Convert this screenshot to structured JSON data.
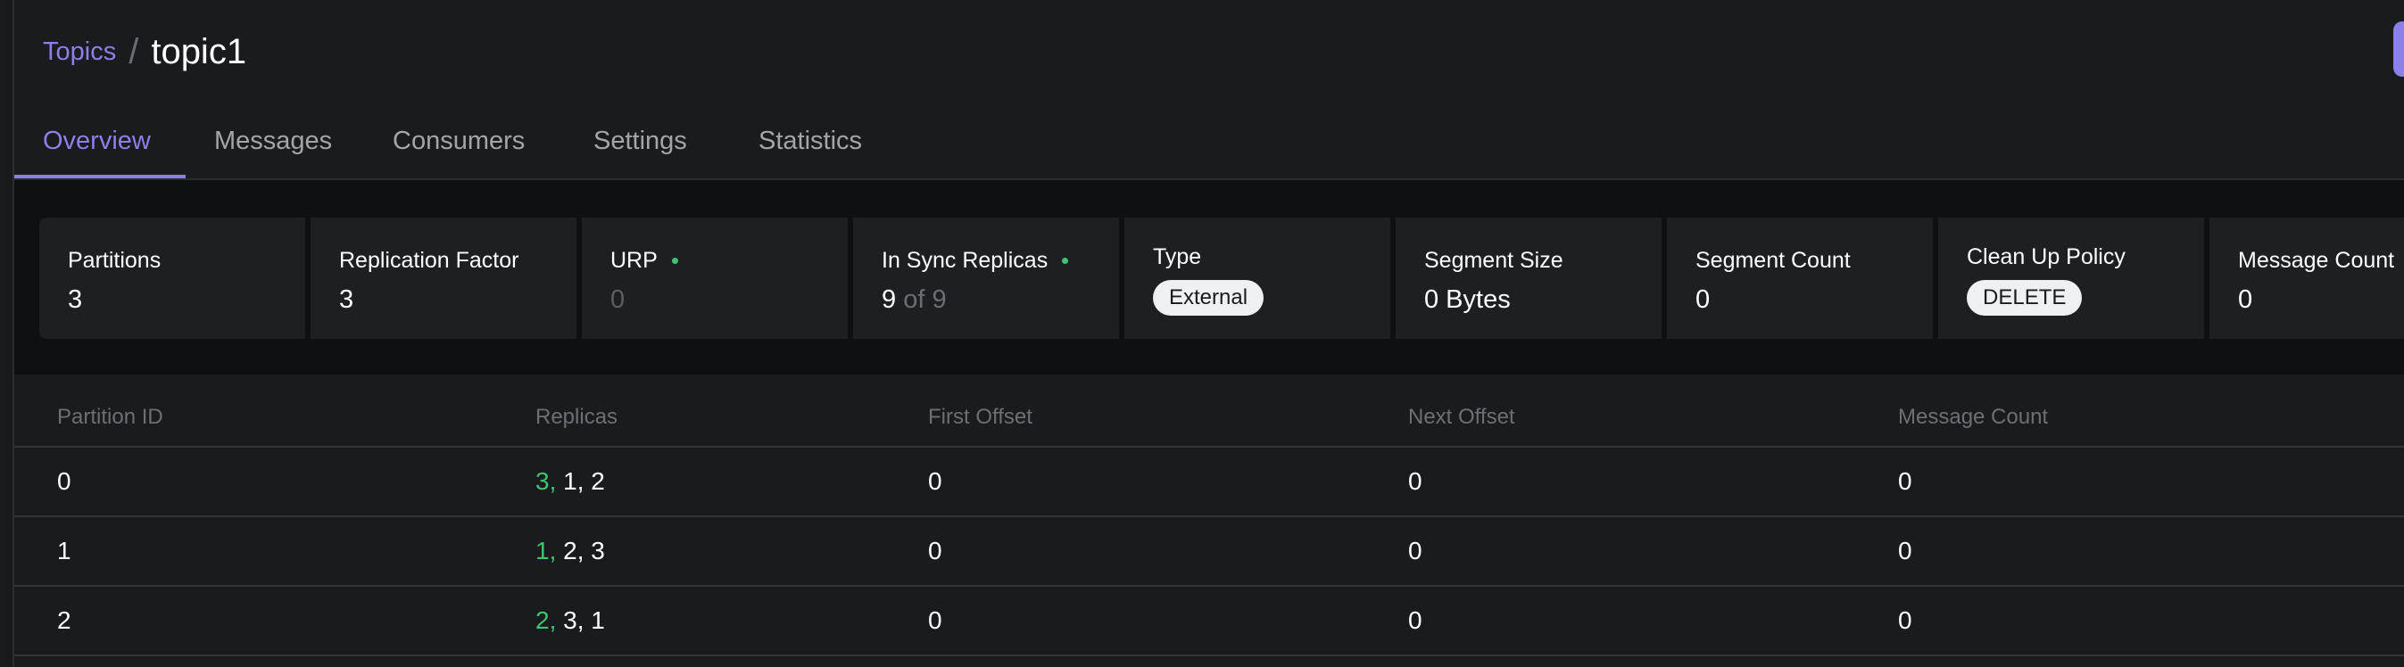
{
  "breadcrumb": {
    "parent": "Topics",
    "separator": "/",
    "current": "topic1"
  },
  "tabs": [
    {
      "label": "Overview",
      "active": true
    },
    {
      "label": "Messages",
      "active": false
    },
    {
      "label": "Consumers",
      "active": false
    },
    {
      "label": "Settings",
      "active": false
    },
    {
      "label": "Statistics",
      "active": false
    }
  ],
  "metrics": {
    "partitions": {
      "label": "Partitions",
      "value": "3"
    },
    "replication_factor": {
      "label": "Replication Factor",
      "value": "3"
    },
    "urp": {
      "label": "URP",
      "value": "0",
      "status_color": "#3ec46d"
    },
    "in_sync_replicas": {
      "label": "In Sync Replicas",
      "value": "9",
      "of_text": "of 9",
      "status_color": "#3ec46d"
    },
    "type": {
      "label": "Type",
      "value": "External"
    },
    "segment_size": {
      "label": "Segment Size",
      "value": "0 Bytes"
    },
    "segment_count": {
      "label": "Segment Count",
      "value": "0"
    },
    "clean_up_policy": {
      "label": "Clean Up Policy",
      "value": "DELETE"
    },
    "message_count": {
      "label": "Message Count",
      "value": "0"
    }
  },
  "table": {
    "columns": [
      "Partition ID",
      "Replicas",
      "First Offset",
      "Next Offset",
      "Message Count"
    ],
    "rows": [
      {
        "partition_id": "0",
        "leader": "3,",
        "replicas_rest": "1, 2",
        "first_offset": "0",
        "next_offset": "0",
        "message_count": "0"
      },
      {
        "partition_id": "1",
        "leader": "1,",
        "replicas_rest": "2, 3",
        "first_offset": "0",
        "next_offset": "0",
        "message_count": "0"
      },
      {
        "partition_id": "2",
        "leader": "2,",
        "replicas_rest": "3, 1",
        "first_offset": "0",
        "next_offset": "0",
        "message_count": "0"
      }
    ]
  },
  "colors": {
    "accent": "#8b7fe8",
    "leader_replica": "#3ec46d",
    "background": "#1a1b1e",
    "metrics_band": "#0f1012",
    "card": "#1e1f23"
  }
}
